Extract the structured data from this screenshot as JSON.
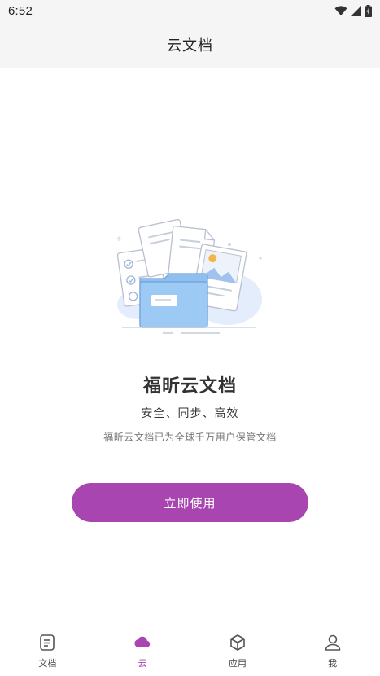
{
  "status_bar": {
    "time": "6:52",
    "icons": [
      "wifi-icon",
      "cellular-signal-icon",
      "battery-icon"
    ]
  },
  "header": {
    "title": "云文档"
  },
  "hero": {
    "illustration_icon": "cloud-documents-illustration",
    "title": "福昕云文档",
    "subtitle": "安全、同步、高效",
    "description": "福昕云文档已为全球千万用户保管文档"
  },
  "cta": {
    "label": "立即使用"
  },
  "tab_bar": {
    "active_index": 1,
    "tabs": [
      {
        "label": "文档",
        "icon": "document-icon"
      },
      {
        "label": "云",
        "icon": "cloud-icon"
      },
      {
        "label": "应用",
        "icon": "cube-icon"
      },
      {
        "label": "我",
        "icon": "person-icon"
      }
    ]
  },
  "colors": {
    "accent": "#a845b0",
    "header_bg": "#f5f5f5",
    "folder_blue": "#8fbfef"
  }
}
